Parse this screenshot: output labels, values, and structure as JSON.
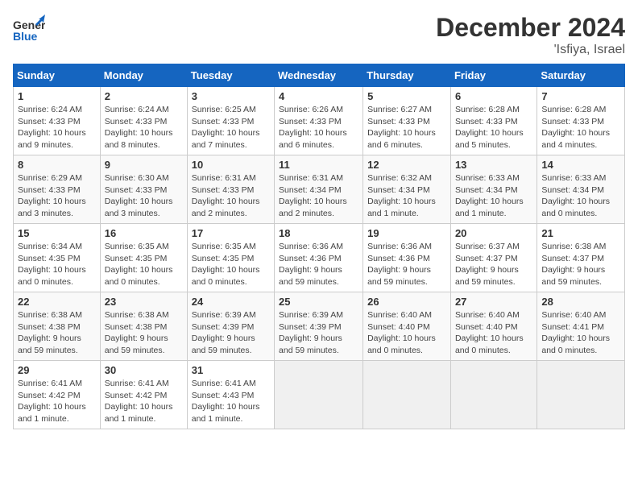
{
  "header": {
    "logo_general": "General",
    "logo_blue": "Blue",
    "month_title": "December 2024",
    "location": "'Isfiya, Israel"
  },
  "days_of_week": [
    "Sunday",
    "Monday",
    "Tuesday",
    "Wednesday",
    "Thursday",
    "Friday",
    "Saturday"
  ],
  "weeks": [
    [
      {
        "day": "1",
        "info": "Sunrise: 6:24 AM\nSunset: 4:33 PM\nDaylight: 10 hours and 9 minutes."
      },
      {
        "day": "2",
        "info": "Sunrise: 6:24 AM\nSunset: 4:33 PM\nDaylight: 10 hours and 8 minutes."
      },
      {
        "day": "3",
        "info": "Sunrise: 6:25 AM\nSunset: 4:33 PM\nDaylight: 10 hours and 7 minutes."
      },
      {
        "day": "4",
        "info": "Sunrise: 6:26 AM\nSunset: 4:33 PM\nDaylight: 10 hours and 6 minutes."
      },
      {
        "day": "5",
        "info": "Sunrise: 6:27 AM\nSunset: 4:33 PM\nDaylight: 10 hours and 6 minutes."
      },
      {
        "day": "6",
        "info": "Sunrise: 6:28 AM\nSunset: 4:33 PM\nDaylight: 10 hours and 5 minutes."
      },
      {
        "day": "7",
        "info": "Sunrise: 6:28 AM\nSunset: 4:33 PM\nDaylight: 10 hours and 4 minutes."
      }
    ],
    [
      {
        "day": "8",
        "info": "Sunrise: 6:29 AM\nSunset: 4:33 PM\nDaylight: 10 hours and 3 minutes."
      },
      {
        "day": "9",
        "info": "Sunrise: 6:30 AM\nSunset: 4:33 PM\nDaylight: 10 hours and 3 minutes."
      },
      {
        "day": "10",
        "info": "Sunrise: 6:31 AM\nSunset: 4:33 PM\nDaylight: 10 hours and 2 minutes."
      },
      {
        "day": "11",
        "info": "Sunrise: 6:31 AM\nSunset: 4:34 PM\nDaylight: 10 hours and 2 minutes."
      },
      {
        "day": "12",
        "info": "Sunrise: 6:32 AM\nSunset: 4:34 PM\nDaylight: 10 hours and 1 minute."
      },
      {
        "day": "13",
        "info": "Sunrise: 6:33 AM\nSunset: 4:34 PM\nDaylight: 10 hours and 1 minute."
      },
      {
        "day": "14",
        "info": "Sunrise: 6:33 AM\nSunset: 4:34 PM\nDaylight: 10 hours and 0 minutes."
      }
    ],
    [
      {
        "day": "15",
        "info": "Sunrise: 6:34 AM\nSunset: 4:35 PM\nDaylight: 10 hours and 0 minutes."
      },
      {
        "day": "16",
        "info": "Sunrise: 6:35 AM\nSunset: 4:35 PM\nDaylight: 10 hours and 0 minutes."
      },
      {
        "day": "17",
        "info": "Sunrise: 6:35 AM\nSunset: 4:35 PM\nDaylight: 10 hours and 0 minutes."
      },
      {
        "day": "18",
        "info": "Sunrise: 6:36 AM\nSunset: 4:36 PM\nDaylight: 9 hours and 59 minutes."
      },
      {
        "day": "19",
        "info": "Sunrise: 6:36 AM\nSunset: 4:36 PM\nDaylight: 9 hours and 59 minutes."
      },
      {
        "day": "20",
        "info": "Sunrise: 6:37 AM\nSunset: 4:37 PM\nDaylight: 9 hours and 59 minutes."
      },
      {
        "day": "21",
        "info": "Sunrise: 6:38 AM\nSunset: 4:37 PM\nDaylight: 9 hours and 59 minutes."
      }
    ],
    [
      {
        "day": "22",
        "info": "Sunrise: 6:38 AM\nSunset: 4:38 PM\nDaylight: 9 hours and 59 minutes."
      },
      {
        "day": "23",
        "info": "Sunrise: 6:38 AM\nSunset: 4:38 PM\nDaylight: 9 hours and 59 minutes."
      },
      {
        "day": "24",
        "info": "Sunrise: 6:39 AM\nSunset: 4:39 PM\nDaylight: 9 hours and 59 minutes."
      },
      {
        "day": "25",
        "info": "Sunrise: 6:39 AM\nSunset: 4:39 PM\nDaylight: 9 hours and 59 minutes."
      },
      {
        "day": "26",
        "info": "Sunrise: 6:40 AM\nSunset: 4:40 PM\nDaylight: 10 hours and 0 minutes."
      },
      {
        "day": "27",
        "info": "Sunrise: 6:40 AM\nSunset: 4:40 PM\nDaylight: 10 hours and 0 minutes."
      },
      {
        "day": "28",
        "info": "Sunrise: 6:40 AM\nSunset: 4:41 PM\nDaylight: 10 hours and 0 minutes."
      }
    ],
    [
      {
        "day": "29",
        "info": "Sunrise: 6:41 AM\nSunset: 4:42 PM\nDaylight: 10 hours and 1 minute."
      },
      {
        "day": "30",
        "info": "Sunrise: 6:41 AM\nSunset: 4:42 PM\nDaylight: 10 hours and 1 minute."
      },
      {
        "day": "31",
        "info": "Sunrise: 6:41 AM\nSunset: 4:43 PM\nDaylight: 10 hours and 1 minute."
      },
      {
        "day": "",
        "info": ""
      },
      {
        "day": "",
        "info": ""
      },
      {
        "day": "",
        "info": ""
      },
      {
        "day": "",
        "info": ""
      }
    ]
  ]
}
